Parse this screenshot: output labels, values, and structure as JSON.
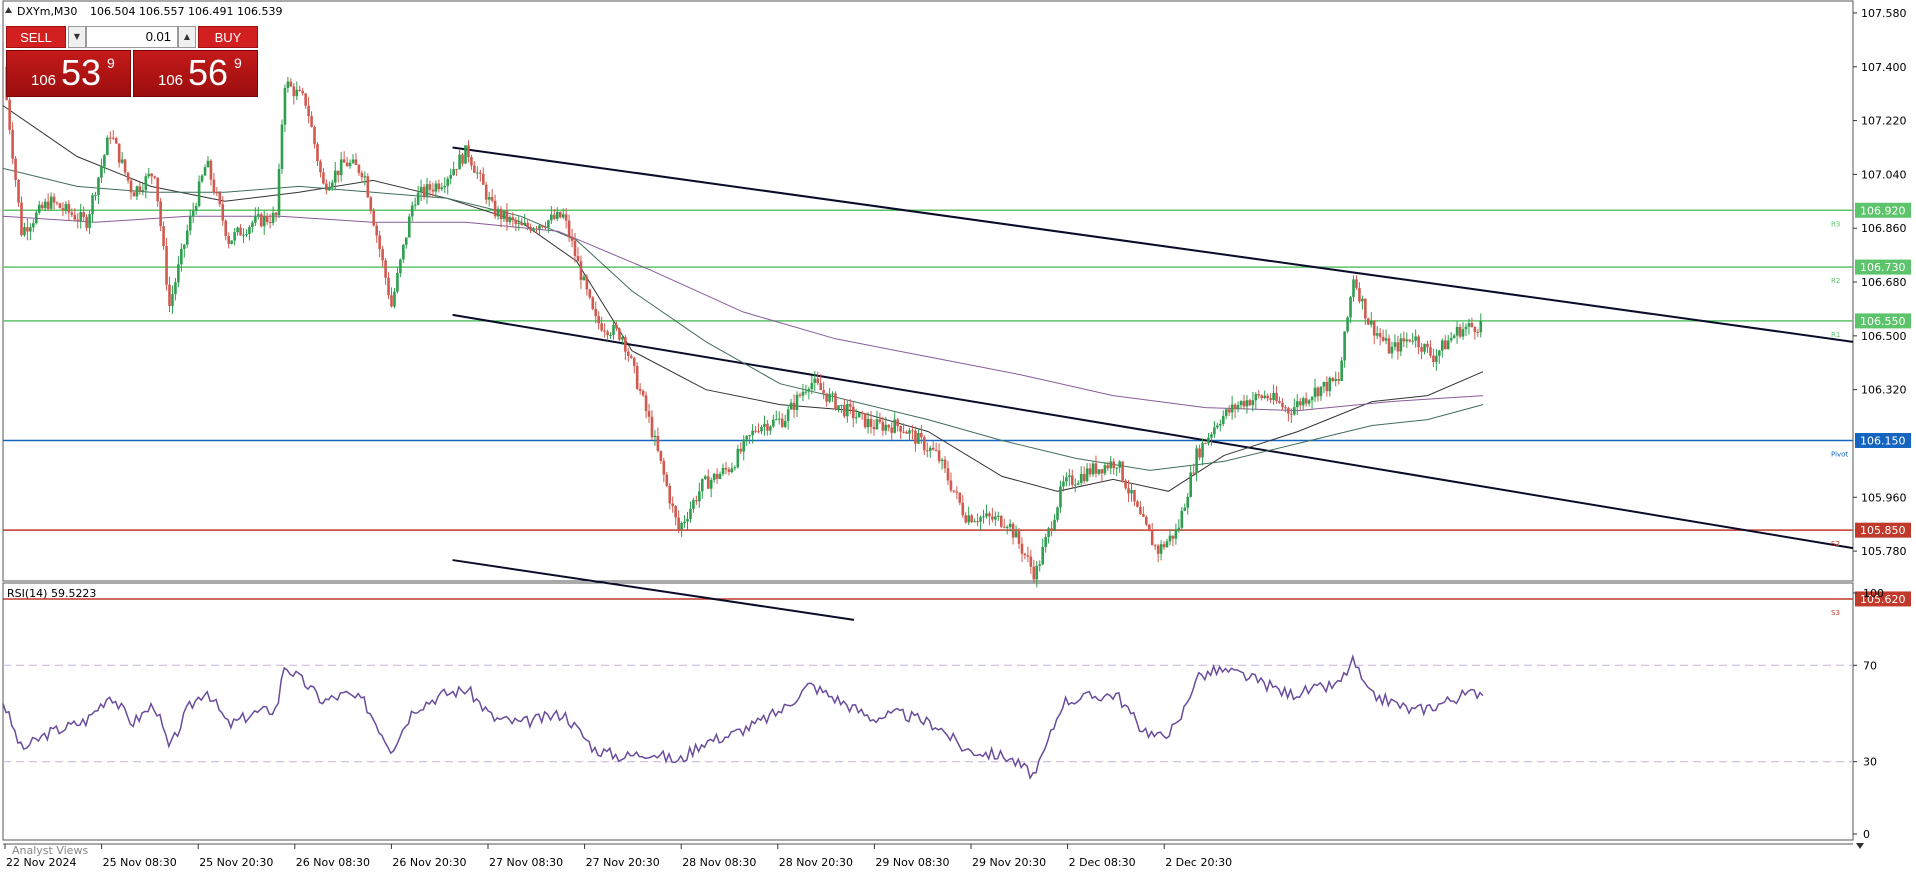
{
  "header": {
    "symbol": "DXYm,M30",
    "ohlc": "106.504 106.557 106.491 106.539"
  },
  "trade_panel": {
    "sell_label": "SELL",
    "buy_label": "BUY",
    "lot": "0.01",
    "sell_small": "106",
    "sell_big": "53",
    "sell_sup": "9",
    "buy_small": "106",
    "buy_big": "56",
    "buy_sup": "9"
  },
  "footer_partial": "Analyst Views",
  "colors": {
    "bull": "#2e9e4f",
    "bear": "#d05a50",
    "resistance": "#5cc46a",
    "pivot": "#1565c0",
    "support": "#c0392b",
    "rsi": "#6a4c9c",
    "ma_fast": "#333333",
    "ma_mid": "#3f6e5a",
    "ma_slow": "#8a5a9a"
  },
  "chart_data": [
    {
      "type": "candlestick",
      "timeframe": "M30",
      "y_range": [
        105.68,
        107.62
      ],
      "y_ticks": [
        "107.580",
        "107.400",
        "107.220",
        "107.040",
        "106.860",
        "106.680",
        "106.500",
        "106.320",
        "105.960",
        "105.780"
      ],
      "x_labels": [
        "22 Nov 2024",
        "25 Nov 08:30",
        "25 Nov 20:30",
        "26 Nov 08:30",
        "26 Nov 20:30",
        "27 Nov 08:30",
        "27 Nov 20:30",
        "28 Nov 08:30",
        "28 Nov 20:30",
        "29 Nov 08:30",
        "29 Nov 20:30",
        "2 Dec 08:30",
        "2 Dec 20:30"
      ],
      "x_range": [
        0,
        100
      ],
      "levels": [
        {
          "label": "R3",
          "value": 106.92,
          "text": "106.920",
          "color": "#5cc46a"
        },
        {
          "label": "R2",
          "value": 106.73,
          "text": "106.730",
          "color": "#5cc46a"
        },
        {
          "label": "R1",
          "value": 106.55,
          "text": "106.550",
          "color": "#5cc46a"
        },
        {
          "label": "Pivot",
          "value": 106.15,
          "text": "106.150",
          "color": "#1565c0"
        },
        {
          "label": "S2",
          "value": 105.85,
          "text": "105.850",
          "color": "#c0392b"
        },
        {
          "label": "S3",
          "value": 105.62,
          "text": "105.620",
          "color": "#c0392b"
        }
      ],
      "channel_lines": [
        {
          "x": [
            24.3,
            100
          ],
          "y": [
            107.13,
            106.48
          ]
        },
        {
          "x": [
            24.3,
            100
          ],
          "y": [
            106.57,
            105.79
          ]
        },
        {
          "x": [
            24.3,
            46.0
          ],
          "y": [
            105.75,
            105.55
          ]
        }
      ],
      "price_path": [
        [
          0,
          107.4
        ],
        [
          1.0,
          106.85
        ],
        [
          2.5,
          106.95
        ],
        [
          4.5,
          106.88
        ],
        [
          5.8,
          107.18
        ],
        [
          7.0,
          106.98
        ],
        [
          8.2,
          107.05
        ],
        [
          9.0,
          106.6
        ],
        [
          10.0,
          106.86
        ],
        [
          11.0,
          107.08
        ],
        [
          12.2,
          106.82
        ],
        [
          13.5,
          106.88
        ],
        [
          14.8,
          106.9
        ],
        [
          15.2,
          107.35
        ],
        [
          16.4,
          107.28
        ],
        [
          17.3,
          107.0
        ],
        [
          18.5,
          107.08
        ],
        [
          19.5,
          107.05
        ],
        [
          21.0,
          106.6
        ],
        [
          22.2,
          106.96
        ],
        [
          23.8,
          107.02
        ],
        [
          25.1,
          107.12
        ],
        [
          26.5,
          106.92
        ],
        [
          28.0,
          106.86
        ],
        [
          30.3,
          106.9
        ],
        [
          32.0,
          106.55
        ],
        [
          33.5,
          106.5
        ],
        [
          35.0,
          106.2
        ],
        [
          36.5,
          105.85
        ],
        [
          37.8,
          106.0
        ],
        [
          39.3,
          106.06
        ],
        [
          40.8,
          106.2
        ],
        [
          42.2,
          106.22
        ],
        [
          43.6,
          106.35
        ],
        [
          45.3,
          106.26
        ],
        [
          47.0,
          106.2
        ],
        [
          48.5,
          106.2
        ],
        [
          50.5,
          106.1
        ],
        [
          52.0,
          105.9
        ],
        [
          54.3,
          105.88
        ],
        [
          55.8,
          105.7
        ],
        [
          57.3,
          106.0
        ],
        [
          58.8,
          106.05
        ],
        [
          60.2,
          106.08
        ],
        [
          61.4,
          105.9
        ],
        [
          62.4,
          105.78
        ],
        [
          63.5,
          105.85
        ],
        [
          64.5,
          106.1
        ],
        [
          65.7,
          106.22
        ],
        [
          67.0,
          106.28
        ],
        [
          68.3,
          106.3
        ],
        [
          69.5,
          106.25
        ],
        [
          71.0,
          106.32
        ],
        [
          72.2,
          106.35
        ],
        [
          73.0,
          106.7
        ],
        [
          73.8,
          106.55
        ],
        [
          75.0,
          106.45
        ],
        [
          76.2,
          106.5
        ],
        [
          77.3,
          106.43
        ],
        [
          78.7,
          106.52
        ],
        [
          80.0,
          106.54
        ]
      ],
      "moving_averages": [
        {
          "name": "fast",
          "path": [
            [
              0,
              107.27
            ],
            [
              4.0,
              107.1
            ],
            [
              8.0,
              107.0
            ],
            [
              12.0,
              106.95
            ],
            [
              16.0,
              106.98
            ],
            [
              20.0,
              107.02
            ],
            [
              24.0,
              106.96
            ],
            [
              28.0,
              106.88
            ],
            [
              31.0,
              106.75
            ],
            [
              34.0,
              106.45
            ],
            [
              38.0,
              106.32
            ],
            [
              42.0,
              106.27
            ],
            [
              46.0,
              106.25
            ],
            [
              50.0,
              106.18
            ],
            [
              54.0,
              106.03
            ],
            [
              57.0,
              105.98
            ],
            [
              60.0,
              106.02
            ],
            [
              63.0,
              105.98
            ],
            [
              66.0,
              106.1
            ],
            [
              70.0,
              106.18
            ],
            [
              74.0,
              106.28
            ],
            [
              77.0,
              106.3
            ],
            [
              80.0,
              106.38
            ]
          ]
        },
        {
          "name": "mid",
          "path": [
            [
              0,
              107.06
            ],
            [
              4.0,
              107.0
            ],
            [
              8.0,
              106.98
            ],
            [
              12.0,
              106.98
            ],
            [
              16.0,
              107.0
            ],
            [
              20.0,
              106.98
            ],
            [
              24.0,
              106.96
            ],
            [
              28.0,
              106.9
            ],
            [
              31.0,
              106.82
            ],
            [
              34.0,
              106.65
            ],
            [
              38.0,
              106.48
            ],
            [
              42.0,
              106.34
            ],
            [
              46.0,
              106.28
            ],
            [
              50.0,
              106.22
            ],
            [
              54.0,
              106.15
            ],
            [
              58.0,
              106.09
            ],
            [
              62.0,
              106.05
            ],
            [
              66.0,
              106.08
            ],
            [
              70.0,
              106.14
            ],
            [
              74.0,
              106.2
            ],
            [
              77.0,
              106.22
            ],
            [
              80.0,
              106.27
            ]
          ]
        },
        {
          "name": "slow",
          "path": [
            [
              0,
              106.9
            ],
            [
              5.0,
              106.88
            ],
            [
              10.0,
              106.9
            ],
            [
              15.0,
              106.9
            ],
            [
              20.0,
              106.88
            ],
            [
              25.0,
              106.88
            ],
            [
              30.0,
              106.85
            ],
            [
              35.0,
              106.72
            ],
            [
              40.0,
              106.58
            ],
            [
              45.0,
              106.49
            ],
            [
              50.0,
              106.43
            ],
            [
              55.0,
              106.37
            ],
            [
              60.0,
              106.3
            ],
            [
              65.0,
              106.26
            ],
            [
              70.0,
              106.25
            ],
            [
              75.0,
              106.28
            ],
            [
              80.0,
              106.3
            ]
          ]
        }
      ]
    },
    {
      "type": "line",
      "title": "RSI(14) 59.5223",
      "series": [
        {
          "name": "RSI(14)",
          "values": [
            [
              0,
              55
            ],
            [
              1.0,
              35
            ],
            [
              2.5,
              42
            ],
            [
              4.5,
              47
            ],
            [
              5.8,
              58
            ],
            [
              7.0,
              46
            ],
            [
              8.2,
              54
            ],
            [
              9.0,
              35
            ],
            [
              10.0,
              52
            ],
            [
              11.0,
              60
            ],
            [
              12.2,
              45
            ],
            [
              13.5,
              50
            ],
            [
              14.8,
              52
            ],
            [
              15.2,
              70
            ],
            [
              16.4,
              62
            ],
            [
              17.3,
              55
            ],
            [
              18.5,
              58
            ],
            [
              19.5,
              55
            ],
            [
              21.0,
              35
            ],
            [
              22.2,
              52
            ],
            [
              23.8,
              58
            ],
            [
              25.1,
              60
            ],
            [
              26.5,
              48
            ],
            [
              28.0,
              46
            ],
            [
              30.3,
              50
            ],
            [
              32.0,
              35
            ],
            [
              33.5,
              32
            ],
            [
              35.0,
              34
            ],
            [
              36.5,
              30
            ],
            [
              37.8,
              38
            ],
            [
              39.3,
              41
            ],
            [
              40.8,
              46
            ],
            [
              42.2,
              52
            ],
            [
              43.6,
              62
            ],
            [
              45.3,
              55
            ],
            [
              47.0,
              48
            ],
            [
              48.5,
              50
            ],
            [
              50.5,
              45
            ],
            [
              52.0,
              35
            ],
            [
              54.3,
              32
            ],
            [
              55.8,
              24
            ],
            [
              57.3,
              55
            ],
            [
              58.8,
              57
            ],
            [
              60.2,
              58
            ],
            [
              61.4,
              45
            ],
            [
              62.4,
              40
            ],
            [
              63.5,
              45
            ],
            [
              64.5,
              65
            ],
            [
              65.7,
              68
            ],
            [
              67.0,
              66
            ],
            [
              68.3,
              62
            ],
            [
              69.5,
              58
            ],
            [
              71.0,
              60
            ],
            [
              72.2,
              62
            ],
            [
              73.0,
              72
            ],
            [
              73.8,
              58
            ],
            [
              75.0,
              55
            ],
            [
              76.2,
              51
            ],
            [
              77.3,
              53
            ],
            [
              78.7,
              57
            ],
            [
              80.0,
              59.5
            ]
          ]
        }
      ],
      "y_range": [
        0,
        100
      ],
      "y_ticks": [
        "100",
        "70",
        "30",
        "0"
      ],
      "levels": [
        70,
        30
      ]
    }
  ]
}
